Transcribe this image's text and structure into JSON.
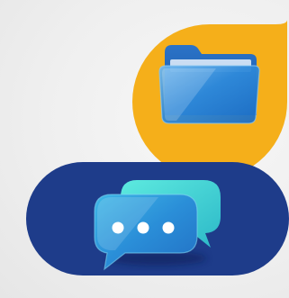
{
  "illustration": {
    "folder_tile": {
      "icon": "folder-icon",
      "shape": "speech-bubble",
      "background_color": "#F5AF1A",
      "folder_back_color": "#1B63B8",
      "folder_front_color": "#2D86D8"
    },
    "chat_pill": {
      "icon": "chat-bubbles-icon",
      "shape": "pill",
      "background_color": "#1E3C8A",
      "bubble_front_color": "#2A8FD8",
      "bubble_back_color": "#43D6D2",
      "typing_dots": 3,
      "dot_color": "#FFFFFF"
    }
  }
}
